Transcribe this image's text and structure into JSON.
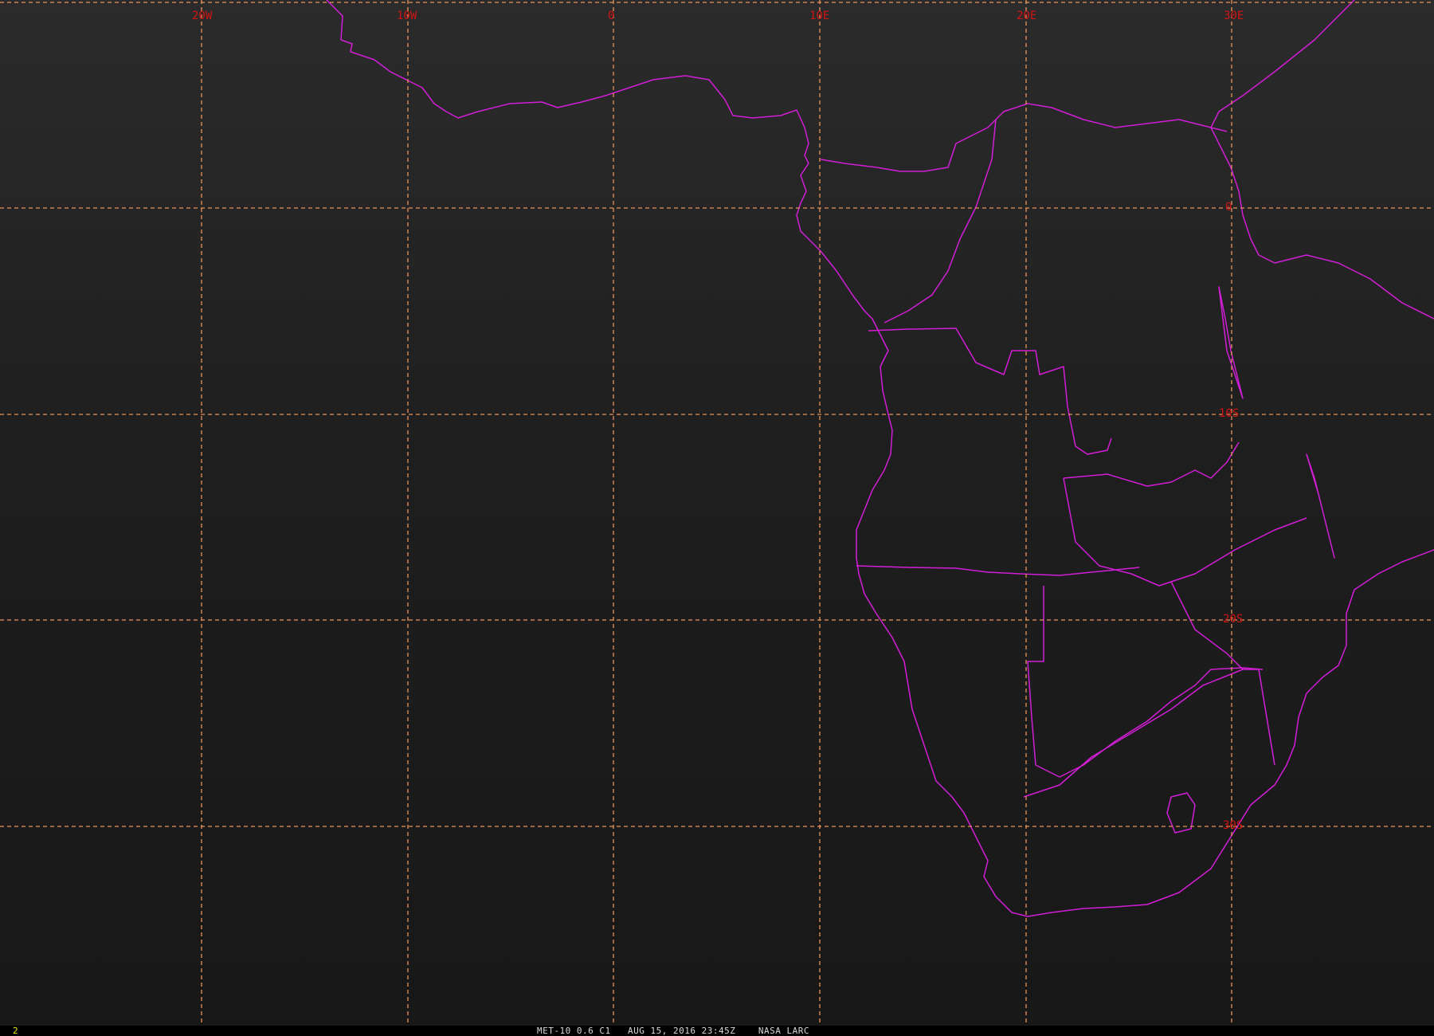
{
  "map": {
    "longitude_labels": [
      "20W",
      "10W",
      "0",
      "10E",
      "20E",
      "30E"
    ],
    "latitude_labels": [
      "0",
      "10S",
      "20S",
      "30S"
    ],
    "colors": {
      "background": "#1c1c1c",
      "gridlines": "#e8945a",
      "grid_labels": "#d01414",
      "boundaries": "#d21ed6"
    }
  },
  "status": {
    "frame_number": "2",
    "satellite": "MET-10",
    "band": "0.6",
    "channel": "C1",
    "date": "AUG 15, 2016",
    "time": "23:45Z",
    "source": "NASA LARC"
  }
}
